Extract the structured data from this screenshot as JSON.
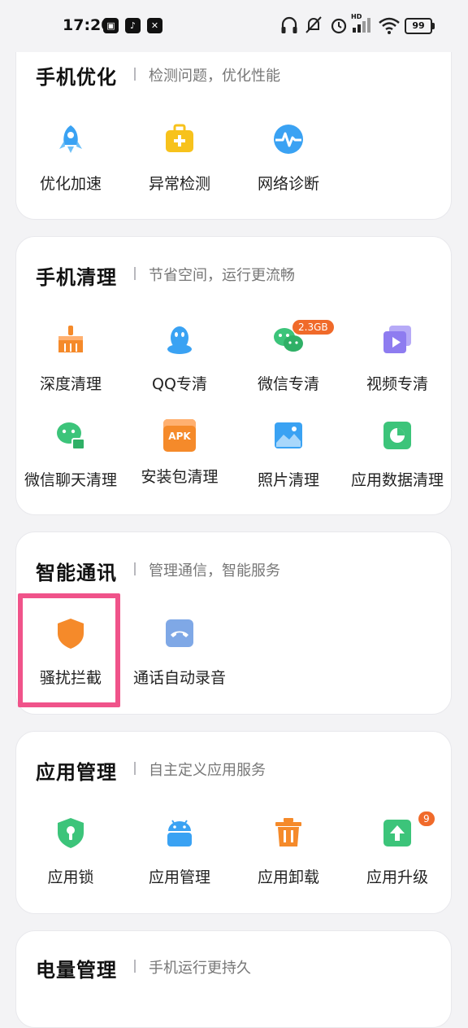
{
  "status_bar": {
    "time": "17:20",
    "battery": "99",
    "hd_label": "HD"
  },
  "sections": {
    "optimize": {
      "title": "手机优化",
      "subtitle": "检测问题，优化性能",
      "items": [
        {
          "label": "优化加速",
          "icon": "rocket-icon"
        },
        {
          "label": "异常检测",
          "icon": "medkit-icon"
        },
        {
          "label": "网络诊断",
          "icon": "network-pulse-icon"
        }
      ]
    },
    "clean": {
      "title": "手机清理",
      "subtitle": "节省空间，运行更流畅",
      "items": [
        {
          "label": "深度清理",
          "icon": "broom-icon"
        },
        {
          "label": "QQ专清",
          "icon": "qq-penguin-icon"
        },
        {
          "label": "微信专清",
          "icon": "wechat-icon",
          "badge": "2.3GB"
        },
        {
          "label": "视频专清",
          "icon": "video-icon"
        },
        {
          "label": "微信聊天清理",
          "icon": "wechat-chat-icon"
        },
        {
          "label": "安装包清理",
          "icon": "apk-icon",
          "icon_text": "APK"
        },
        {
          "label": "照片清理",
          "icon": "photo-icon"
        },
        {
          "label": "应用数据清理",
          "icon": "pie-chart-icon"
        }
      ]
    },
    "comm": {
      "title": "智能通讯",
      "subtitle": "管理通信，智能服务",
      "items": [
        {
          "label": "骚扰拦截",
          "icon": "shield-icon"
        },
        {
          "label": "通话自动录音",
          "icon": "call-record-icon"
        }
      ]
    },
    "apps": {
      "title": "应用管理",
      "subtitle": "自主定义应用服务",
      "items": [
        {
          "label": "应用锁",
          "icon": "lock-shield-icon"
        },
        {
          "label": "应用管理",
          "icon": "android-icon"
        },
        {
          "label": "应用卸载",
          "icon": "trash-icon"
        },
        {
          "label": "应用升级",
          "icon": "upgrade-icon",
          "badge": "9"
        }
      ]
    },
    "battery_mgmt": {
      "title": "电量管理",
      "subtitle": "手机运行更持久"
    }
  },
  "colors": {
    "accent_blue": "#3aa2f3",
    "accent_orange": "#f58a2a",
    "accent_yellow": "#f7c21c",
    "accent_green": "#3cc47a",
    "accent_purple": "#8e7cf0",
    "highlight_pink": "#f0538a"
  }
}
